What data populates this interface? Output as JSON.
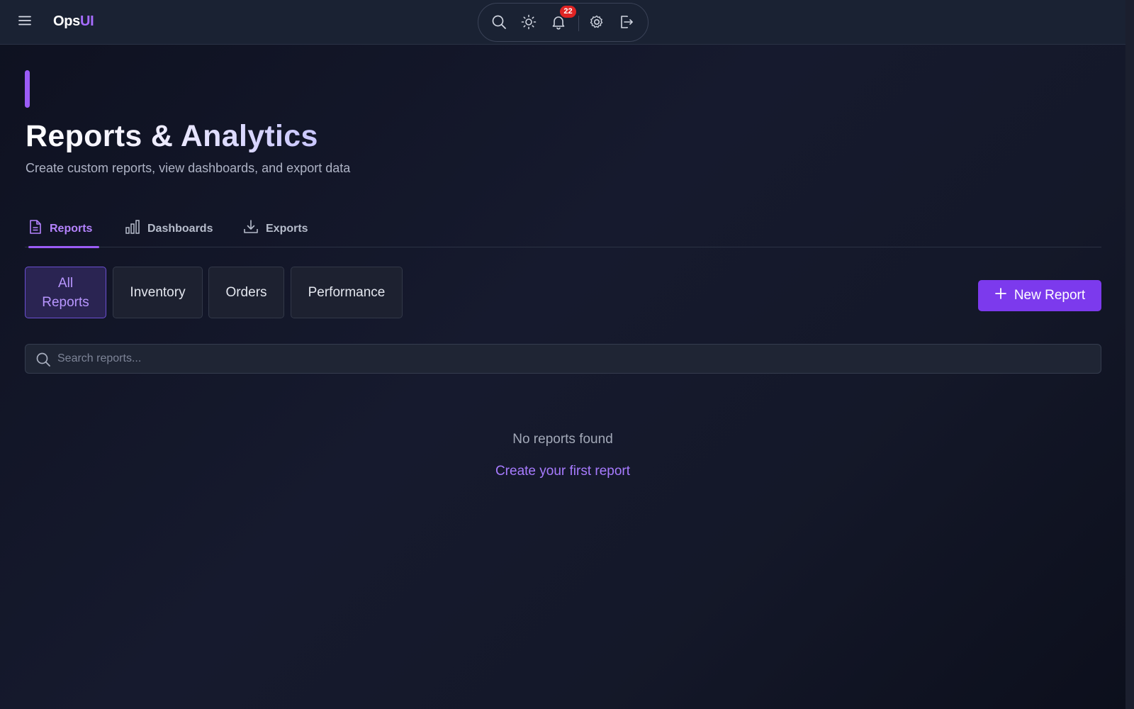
{
  "app": {
    "brand_prefix": "Ops",
    "brand_suffix": "UI",
    "notification_count": "22",
    "colors": {
      "accent": "#9b5cf6",
      "button": "#7c3aed",
      "badge": "#e02424",
      "link": "#a77bff"
    }
  },
  "toolbar": {
    "icons": [
      "menu-icon",
      "search-icon",
      "sun-icon",
      "bell-icon",
      "gear-icon",
      "logout-icon"
    ]
  },
  "header": {
    "title": "Reports & Analytics",
    "subtitle": "Create custom reports, view dashboards, and export data"
  },
  "tabs": [
    {
      "label": "Reports",
      "icon": "file-text-icon",
      "active": true
    },
    {
      "label": "Dashboards",
      "icon": "bar-chart-icon",
      "active": false
    },
    {
      "label": "Exports",
      "icon": "download-icon",
      "active": false
    }
  ],
  "filters": [
    {
      "label": "All Reports",
      "active": true
    },
    {
      "label": "Inventory",
      "active": false
    },
    {
      "label": "Orders",
      "active": false
    },
    {
      "label": "Performance",
      "active": false
    }
  ],
  "actions": {
    "new_report_label": "New Report"
  },
  "search": {
    "placeholder": "Search reports...",
    "value": ""
  },
  "empty_state": {
    "message": "No reports found",
    "link_label": "Create your first report"
  }
}
